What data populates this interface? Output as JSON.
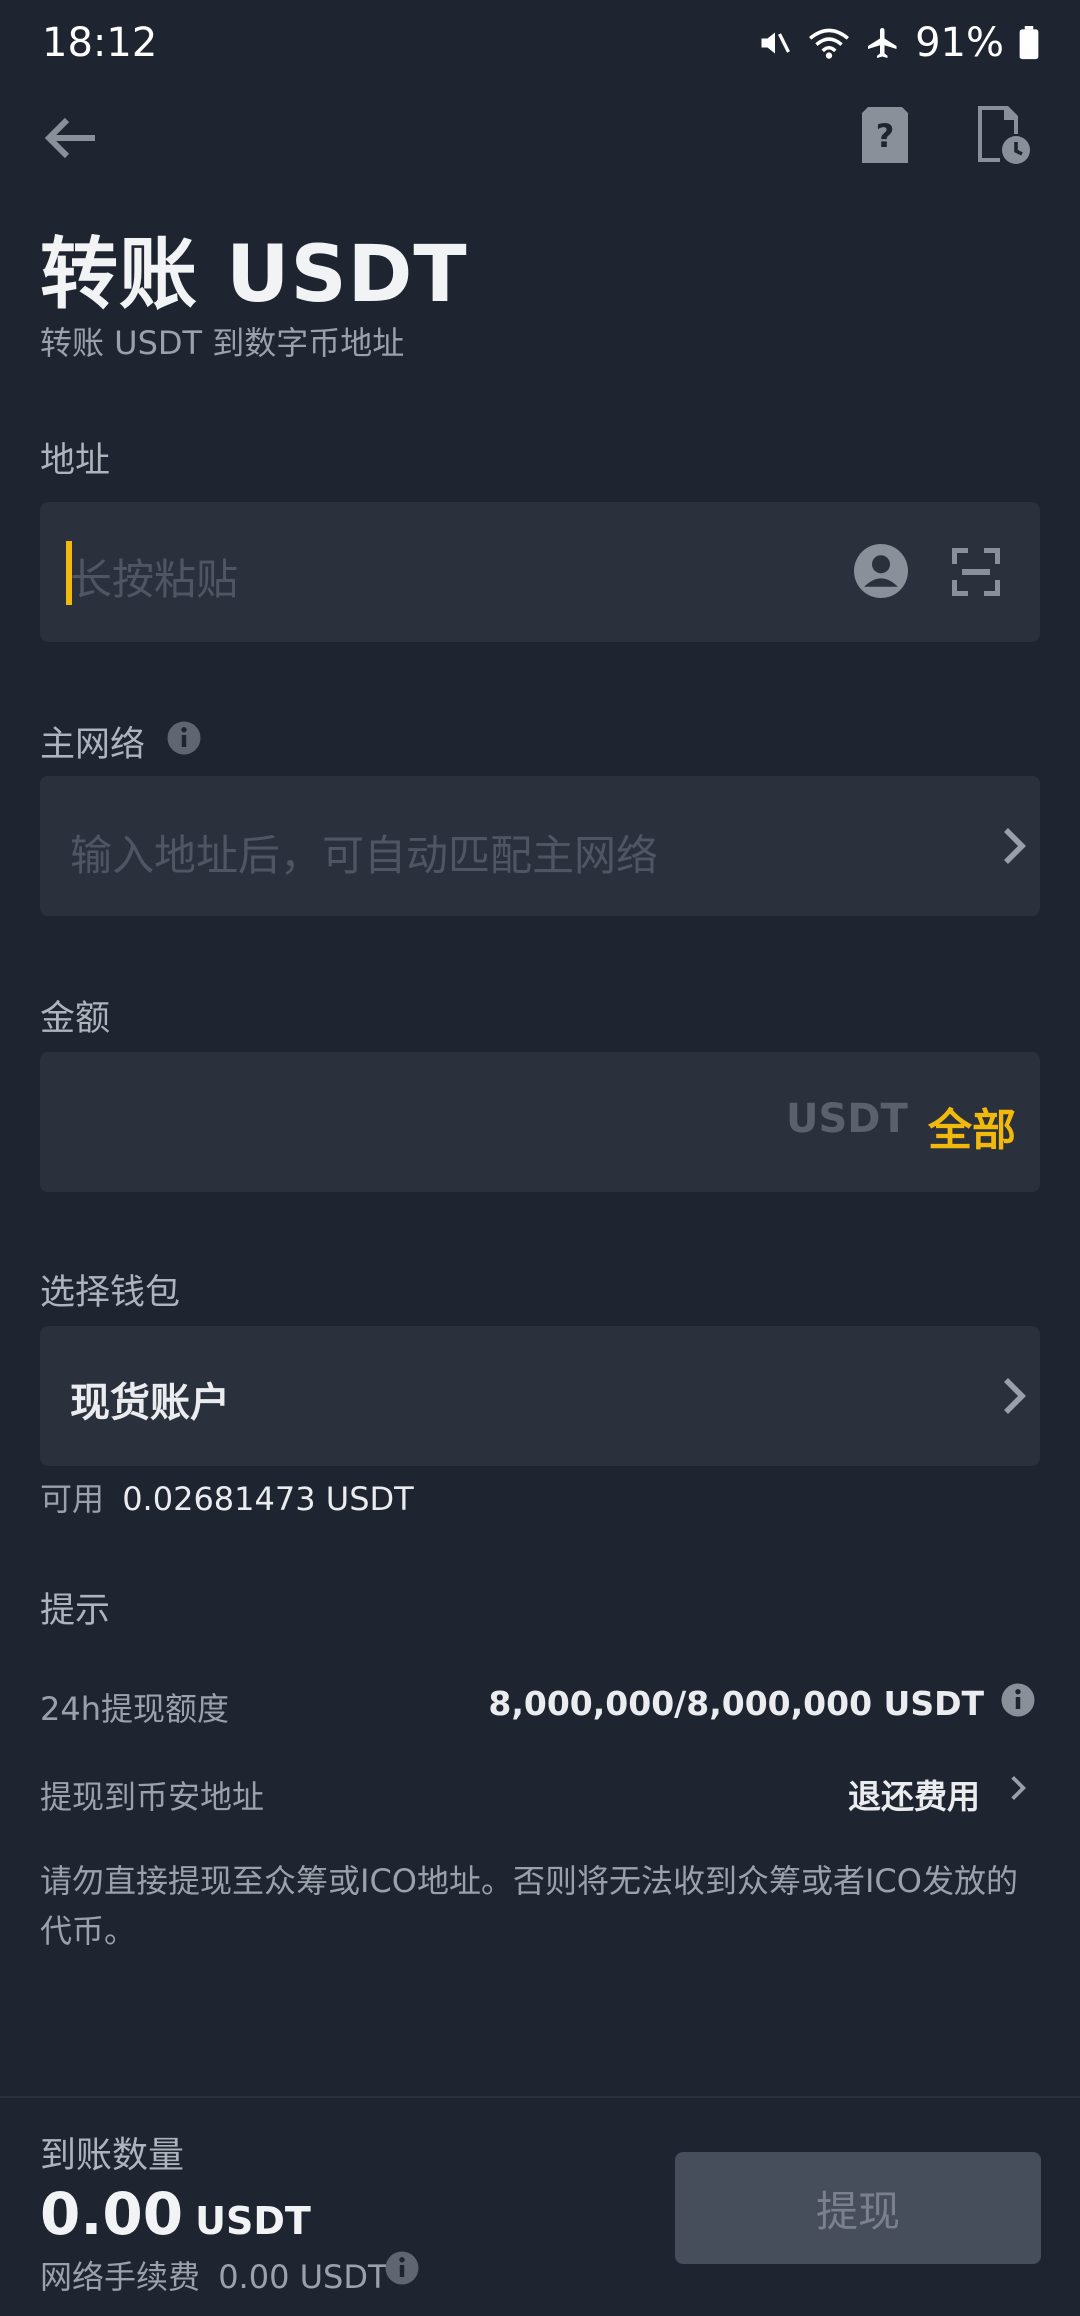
{
  "status_bar": {
    "time": "18:12",
    "battery": "91%"
  },
  "page": {
    "title": "转账 USDT",
    "subtitle": "转账 USDT 到数字币地址"
  },
  "address": {
    "label": "地址",
    "placeholder": "长按粘贴"
  },
  "network": {
    "label": "主网络",
    "placeholder": "输入地址后，可自动匹配主网络"
  },
  "amount": {
    "label": "金额",
    "unit": "USDT",
    "all_label": "全部"
  },
  "wallet": {
    "label": "选择钱包",
    "value": "现货账户",
    "available_label": "可用",
    "available_value": "0.02681473 USDT"
  },
  "tips": {
    "label": "提示",
    "limit_label": "24h提现额度",
    "limit_value": "8,000,000/8,000,000 USDT",
    "binance_label": "提现到币安地址",
    "binance_value": "退还费用",
    "warning": "请勿直接提现至众筹或ICO地址。否则将无法收到众筹或者ICO发放的代币。"
  },
  "footer": {
    "receive_label": "到账数量",
    "receive_amount": "0.00",
    "receive_unit": "USDT",
    "fee_label": "网络手续费",
    "fee_value": "0.00 USDT",
    "withdraw_label": "提现"
  },
  "colors": {
    "background": "#1f2530",
    "field": "#2b313c",
    "accent": "#f0b90b",
    "button_disabled": "#474e5b"
  },
  "icons": [
    "back-arrow-icon",
    "help-document-icon",
    "history-document-icon",
    "contact-icon",
    "scan-icon",
    "info-icon",
    "chevron-right-icon",
    "mute-icon",
    "wifi-icon",
    "airplane-icon",
    "battery-icon"
  ]
}
